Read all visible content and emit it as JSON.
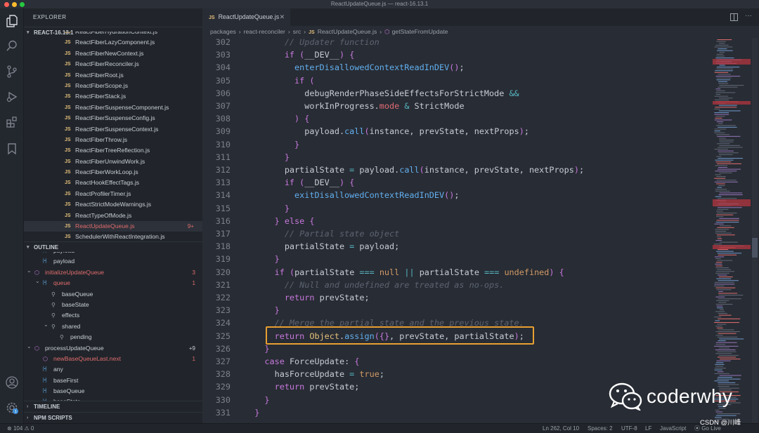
{
  "window": {
    "title": "ReactUpdateQueue.js — react-16.13.1"
  },
  "sidebar": {
    "title": "EXPLORER",
    "project": "REACT-16.13.1",
    "files": [
      {
        "name": "ReactFiberHydrationContext.js"
      },
      {
        "name": "ReactFiberLazyComponent.js"
      },
      {
        "name": "ReactFiberNewContext.js"
      },
      {
        "name": "ReactFiberReconciler.js"
      },
      {
        "name": "ReactFiberRoot.js"
      },
      {
        "name": "ReactFiberScope.js"
      },
      {
        "name": "ReactFiberStack.js"
      },
      {
        "name": "ReactFiberSuspenseComponent.js"
      },
      {
        "name": "ReactFiberSuspenseConfig.js"
      },
      {
        "name": "ReactFiberSuspenseContext.js"
      },
      {
        "name": "ReactFiberThrow.js"
      },
      {
        "name": "ReactFiberTreeReflection.js"
      },
      {
        "name": "ReactFiberUnwindWork.js"
      },
      {
        "name": "ReactFiberWorkLoop.js"
      },
      {
        "name": "ReactHookEffectTags.js"
      },
      {
        "name": "ReactProfilerTimer.js"
      },
      {
        "name": "ReactStrictModeWarnings.js"
      },
      {
        "name": "ReactTypeOfMode.js"
      },
      {
        "name": "ReactUpdateQueue.js",
        "badge": "9+"
      },
      {
        "name": "SchedulerWithReactIntegration.js"
      }
    ],
    "outline_title": "OUTLINE",
    "outline": [
      {
        "label": "payload",
        "count": ""
      },
      {
        "label": "payload",
        "count": ""
      },
      {
        "label": "initializeUpdateQueue",
        "count": "3"
      },
      {
        "label": "queue",
        "count": "1"
      },
      {
        "label": "baseQueue",
        "count": ""
      },
      {
        "label": "baseState",
        "count": ""
      },
      {
        "label": "effects",
        "count": ""
      },
      {
        "label": "shared",
        "count": ""
      },
      {
        "label": "pending",
        "count": ""
      },
      {
        "label": "processUpdateQueue",
        "count": "+9"
      },
      {
        "label": "newBaseQueueLast.next",
        "count": "1"
      },
      {
        "label": "any",
        "count": ""
      },
      {
        "label": "baseFirst",
        "count": ""
      },
      {
        "label": "baseQueue",
        "count": ""
      },
      {
        "label": "baseState",
        "count": ""
      }
    ],
    "timeline": "TIMELINE",
    "npm": "NPM SCRIPTS"
  },
  "editor": {
    "tab": "ReactUpdateQueue.js",
    "breadcrumbs": [
      "packages",
      "react-reconciler",
      "src",
      "ReactUpdateQueue.js",
      "getStateFromUpdate"
    ],
    "lines": [
      {
        "n": "302",
        "code": "        // Updater function"
      },
      {
        "n": "303",
        "code": "        if (__DEV__) {"
      },
      {
        "n": "304",
        "code": "          enterDisallowedContextReadInDEV();"
      },
      {
        "n": "305",
        "code": "          if ("
      },
      {
        "n": "306",
        "code": "            debugRenderPhaseSideEffectsForStrictMode &&"
      },
      {
        "n": "307",
        "code": "            workInProgress.mode & StrictMode"
      },
      {
        "n": "308",
        "code": "          ) {"
      },
      {
        "n": "309",
        "code": "            payload.call(instance, prevState, nextProps);"
      },
      {
        "n": "310",
        "code": "          }"
      },
      {
        "n": "311",
        "code": "        }"
      },
      {
        "n": "312",
        "code": "        partialState = payload.call(instance, prevState, nextProps);"
      },
      {
        "n": "313",
        "code": "        if (__DEV__) {"
      },
      {
        "n": "314",
        "code": "          exitDisallowedContextReadInDEV();"
      },
      {
        "n": "315",
        "code": "        }"
      },
      {
        "n": "316",
        "code": "      } else {"
      },
      {
        "n": "317",
        "code": "        // Partial state object"
      },
      {
        "n": "318",
        "code": "        partialState = payload;"
      },
      {
        "n": "319",
        "code": "      }"
      },
      {
        "n": "320",
        "code": "      if (partialState === null || partialState === undefined) {"
      },
      {
        "n": "321",
        "code": "        // Null and undefined are treated as no-ops."
      },
      {
        "n": "322",
        "code": "        return prevState;"
      },
      {
        "n": "323",
        "code": "      }"
      },
      {
        "n": "324",
        "code": "      // Merge the partial state and the previous state."
      },
      {
        "n": "325",
        "code": "      return Object.assign({}, prevState, partialState);"
      },
      {
        "n": "326",
        "code": "    }"
      },
      {
        "n": "327",
        "code": "    case ForceUpdate: {"
      },
      {
        "n": "328",
        "code": "      hasForceUpdate = true;"
      },
      {
        "n": "329",
        "code": "      return prevState;"
      },
      {
        "n": "330",
        "code": "    }"
      },
      {
        "n": "331",
        "code": "  }"
      }
    ]
  },
  "status": {
    "errors": "104",
    "warnings": "0",
    "position": "Ln 262, Col 10",
    "spaces": "Spaces: 2",
    "encoding": "UTF-8",
    "eol": "LF",
    "language": "JavaScript",
    "golive": "Go Live",
    "csdn": "CSDN @川峰"
  },
  "watermark": {
    "text": "coderwhy"
  },
  "colors": {
    "highlight_box": "#e8a032",
    "modified": "#e06c6c",
    "accent": "#61afef"
  }
}
